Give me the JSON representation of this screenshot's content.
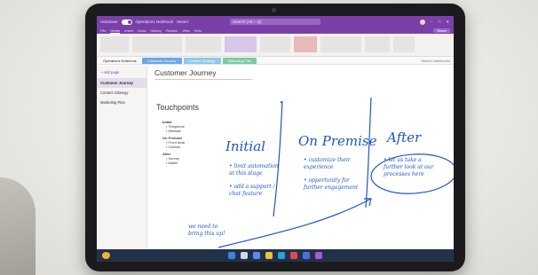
{
  "app": {
    "autosave_label": "AutoSave",
    "notebook_title": "Operations Notebook",
    "window_title_suffix": "Saved",
    "search_placeholder": "Search (Alt + Q)"
  },
  "menu": {
    "items": [
      "File",
      "Home",
      "Insert",
      "Draw",
      "History",
      "Review",
      "View",
      "Help"
    ],
    "active_index": 1,
    "share_label": "Share"
  },
  "sections": {
    "notebook_name": "Operations Notebook",
    "tabs": [
      "Customer Journey",
      "Content Strategy",
      "Marketing Plan"
    ],
    "search_label": "Search Notebooks"
  },
  "pages": {
    "add_page_label": "+ Add page",
    "items": [
      "Customer Journey",
      "Content Strategy",
      "Marketing Plan"
    ],
    "selected_index": 0
  },
  "note": {
    "title": "Customer Journey",
    "touchpoints_heading": "Touchpoints",
    "touchpoints": [
      {
        "label": "Initial",
        "items": [
          "Telephone",
          "Website"
        ]
      },
      {
        "label": "On Premise",
        "items": [
          "Front desk",
          "Cashier"
        ]
      },
      {
        "label": "After",
        "items": [
          "Survey",
          "Mailer"
        ]
      }
    ],
    "ink": {
      "initial": "Initial",
      "on_premise": "On Premise",
      "after": "After",
      "initial_note_1": [
        "• limit automation",
        "at this stage"
      ],
      "initial_note_2": [
        "• add a support /",
        "chat feature"
      ],
      "premise_note_1": [
        "• customize their",
        "experience"
      ],
      "premise_note_2": [
        "• opportunity for",
        "further engagement"
      ],
      "after_note": [
        "• let us take a",
        "further look at our",
        "processes here"
      ],
      "bottom_note": [
        "we need to",
        "bring this up!"
      ]
    }
  },
  "colors": {
    "brand_purple": "#7a3fa9",
    "ink_blue": "#1e55c8",
    "taskbar": "#23304a"
  },
  "taskbar_icons": [
    "start-icon",
    "search-icon",
    "file-explorer-icon",
    "store-icon",
    "edge-icon",
    "onenote-icon",
    "teams-icon",
    "settings-icon"
  ]
}
